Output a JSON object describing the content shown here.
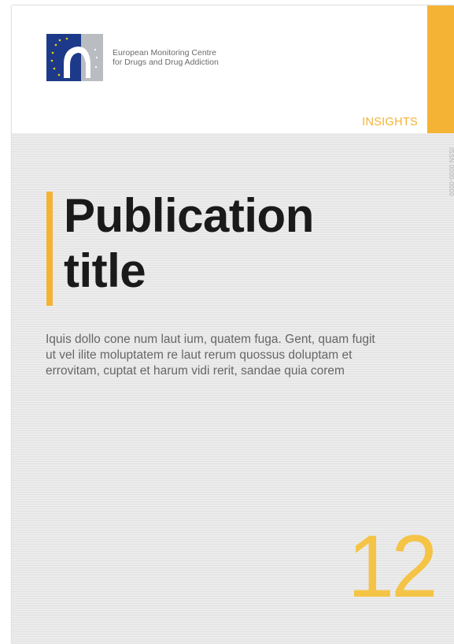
{
  "header": {
    "organisation_line1": "European Monitoring Centre",
    "organisation_line2": "for Drugs and Drug Addiction",
    "series": "INSIGHTS",
    "language": "EN"
  },
  "issn": "ISSN 0000-0000",
  "cover": {
    "title_line1": "Publication",
    "title_line2": "title",
    "summary": "Iquis dollo cone num laut ium, quatem fuga. Gent, quam fugit ut vel ilite moluptatem re laut rerum quossus doluptam et errovitam, cuptat et harum vidi rerit, sandae quia corem",
    "issue_number": "12"
  },
  "colors": {
    "accent": "#f5b335",
    "logo_blue": "#1d3a8a",
    "logo_grey": "#b9bcc1",
    "title": "#1a1a1a",
    "body_text": "#666666"
  },
  "icons": {
    "logo": "emcdda-logo-icon"
  }
}
